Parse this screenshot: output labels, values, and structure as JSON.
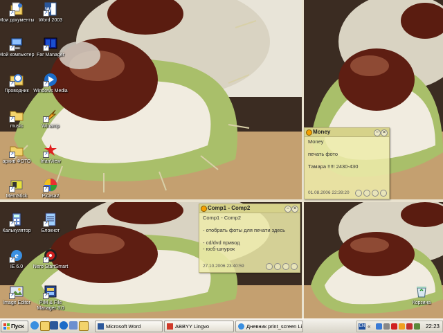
{
  "desktop": {
    "icons": [
      {
        "label": "Мои документы",
        "icon": "my-documents-icon"
      },
      {
        "label": "Word 2003",
        "icon": "word-icon"
      },
      {
        "label": "Мой компьютер",
        "icon": "my-computer-icon"
      },
      {
        "label": "Far Manager",
        "icon": "far-manager-icon"
      },
      {
        "label": "Проводник",
        "icon": "explorer-icon"
      },
      {
        "label": "Windows Media",
        "icon": "windows-media-icon"
      },
      {
        "label": "music",
        "icon": "folder-icon"
      },
      {
        "label": "Winamp",
        "icon": "winamp-icon"
      },
      {
        "label": "архив ФОТО",
        "icon": "folder-icon"
      },
      {
        "label": "IrfanView",
        "icon": "irfanview-icon"
      },
      {
        "label": "MemStick",
        "icon": "memstick-icon"
      },
      {
        "label": "Picasa2",
        "icon": "picasa-icon"
      },
      {
        "label": "Калькулятор",
        "icon": "calculator-icon"
      },
      {
        "label": "Блокнот",
        "icon": "notepad-icon"
      },
      {
        "label": "IE 6.0",
        "icon": "internet-explorer-icon"
      },
      {
        "label": "Nero StartSmart",
        "icon": "nero-icon"
      },
      {
        "label": "Image Editor",
        "icon": "image-editor-icon"
      },
      {
        "label": "PIM & File Manager 3.0",
        "icon": "pim-file-manager-icon"
      },
      {
        "label": "Корзина",
        "icon": "recycle-bin-icon"
      }
    ]
  },
  "notes": {
    "money": {
      "title": "Money",
      "lines": [
        "Money",
        "",
        "печать фото",
        "",
        "Тамара !!!!! 2430-430"
      ],
      "date": "01.08.2006 22:39:20"
    },
    "comp": {
      "title": "Comp1 - Comp2",
      "lines": [
        "Comp1 - Comp2",
        "",
        "- отобрать фоты для печати здесь",
        "",
        "- cd/dvd привод",
        "- юсб-шнурок"
      ],
      "date": "27.10.2006 23:40:59"
    }
  },
  "taskbar": {
    "start_label": "Пуск",
    "tasks": [
      {
        "label": "Microsoft Word",
        "icon": "word-icon"
      },
      {
        "label": "ABBYY Lingvo",
        "icon": "lingvo-icon"
      },
      {
        "label": "Дневник print_screen Li...",
        "icon": "browser-icon"
      }
    ],
    "tray": {
      "lang": "EN",
      "clock": "22:23"
    }
  },
  "colors": {
    "note_bg": "#eeebaa",
    "note_title": "#d6d28a",
    "taskbar": "#e4e0d6"
  }
}
